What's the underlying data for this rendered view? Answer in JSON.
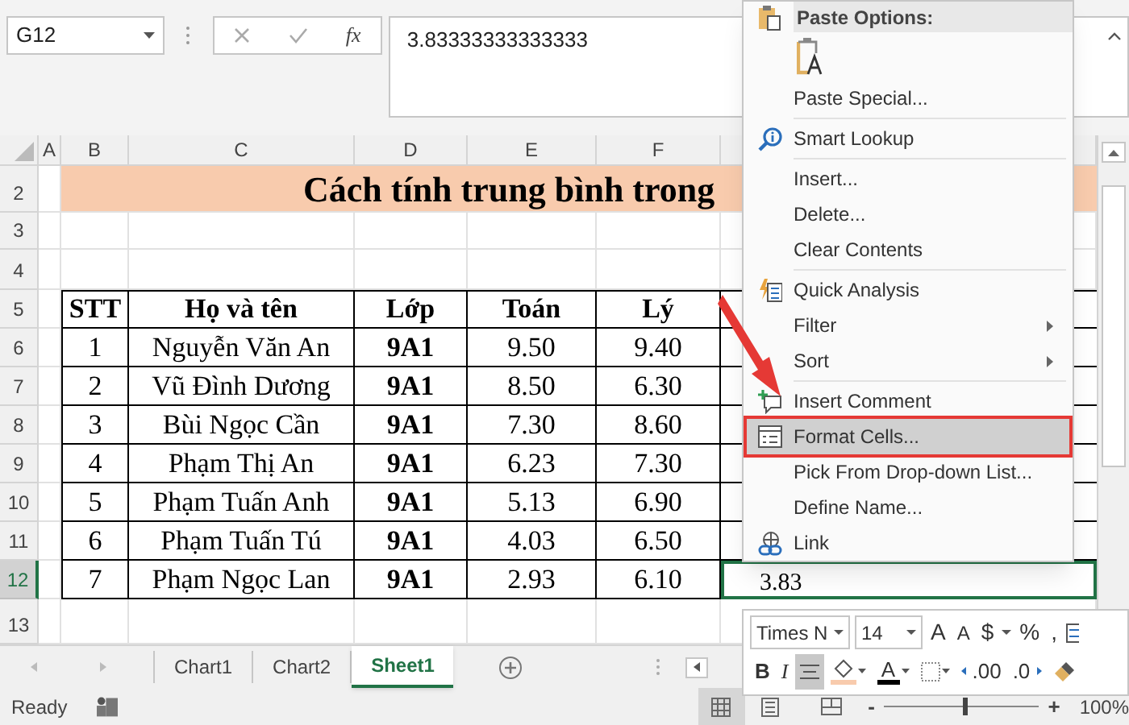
{
  "name_box": "G12",
  "formula_bar": {
    "function_label": "fx",
    "value": "3.83333333333333"
  },
  "column_headers": [
    "A",
    "B",
    "C",
    "D",
    "E",
    "F"
  ],
  "row_headers": [
    {
      "label": "2",
      "selected": false
    },
    {
      "label": "3",
      "selected": false
    },
    {
      "label": "4",
      "selected": false
    },
    {
      "label": "5",
      "selected": false
    },
    {
      "label": "6",
      "selected": false
    },
    {
      "label": "7",
      "selected": false
    },
    {
      "label": "8",
      "selected": false
    },
    {
      "label": "9",
      "selected": false
    },
    {
      "label": "10",
      "selected": false
    },
    {
      "label": "11",
      "selected": false
    },
    {
      "label": "12",
      "selected": true
    },
    {
      "label": "13",
      "selected": false
    }
  ],
  "title": "Cách tính trung bình trong",
  "table": {
    "columns": [
      "STT",
      "Họ và tên",
      "Lớp",
      "Toán",
      "Lý"
    ],
    "rows": [
      [
        "1",
        "Nguyễn Văn An",
        "9A1",
        "9.50",
        "9.40"
      ],
      [
        "2",
        "Vũ Đình Dương",
        "9A1",
        "8.50",
        "6.30"
      ],
      [
        "3",
        "Bùi Ngọc Cần",
        "9A1",
        "7.30",
        "8.60"
      ],
      [
        "4",
        "Phạm Thị An",
        "9A1",
        "6.23",
        "7.30"
      ],
      [
        "5",
        "Phạm Tuấn Anh",
        "9A1",
        "5.13",
        "6.90"
      ],
      [
        "6",
        "Phạm Tuấn Tú",
        "9A1",
        "4.03",
        "6.50"
      ],
      [
        "7",
        "Phạm Ngọc Lan",
        "9A1",
        "2.93",
        "6.10"
      ]
    ]
  },
  "active_cell": {
    "value": "3.83"
  },
  "context_menu": {
    "header": "Paste Options:",
    "items": [
      {
        "kind": "paste-button"
      },
      {
        "kind": "plain",
        "label": "Paste Special...",
        "submenu": false,
        "selected": false
      },
      {
        "kind": "separator"
      },
      {
        "kind": "lookup",
        "label": "Smart Lookup",
        "submenu": false,
        "selected": false
      },
      {
        "kind": "separator"
      },
      {
        "kind": "plain",
        "label": "Insert...",
        "submenu": false,
        "selected": false
      },
      {
        "kind": "plain",
        "label": "Delete...",
        "submenu": false,
        "selected": false
      },
      {
        "kind": "plain",
        "label": "Clear Contents",
        "submenu": false,
        "selected": false
      },
      {
        "kind": "separator"
      },
      {
        "kind": "analysis",
        "label": "Quick Analysis",
        "submenu": false,
        "selected": false
      },
      {
        "kind": "plain",
        "label": "Filter",
        "submenu": true,
        "selected": false
      },
      {
        "kind": "plain",
        "label": "Sort",
        "submenu": true,
        "selected": false
      },
      {
        "kind": "separator"
      },
      {
        "kind": "comment",
        "label": "Insert Comment",
        "submenu": false,
        "selected": false
      },
      {
        "kind": "format",
        "label": "Format Cells...",
        "submenu": false,
        "selected": true
      },
      {
        "kind": "plain",
        "label": "Pick From Drop-down List...",
        "submenu": false,
        "selected": false
      },
      {
        "kind": "plain",
        "label": "Define Name...",
        "submenu": false,
        "selected": false
      },
      {
        "kind": "link",
        "label": "Link",
        "submenu": false,
        "selected": false
      }
    ]
  },
  "mini_toolbar": {
    "font": "Times N",
    "size": "14",
    "top_buttons": [
      {
        "kind": "grow",
        "label": "A"
      },
      {
        "kind": "shrink",
        "label": "A"
      },
      {
        "kind": "text",
        "label": "$"
      },
      {
        "kind": "caret"
      },
      {
        "kind": "text",
        "label": "%"
      },
      {
        "kind": "text",
        "label": ","
      },
      {
        "kind": "wrap"
      }
    ],
    "bottom_buttons": [
      {
        "kind": "bold",
        "label": "B",
        "selected": false
      },
      {
        "kind": "italic",
        "label": "I",
        "selected": false
      },
      {
        "kind": "align",
        "selected": true
      },
      {
        "kind": "fill",
        "selected": false
      },
      {
        "kind": "font-color",
        "label": "A",
        "selected": false
      },
      {
        "kind": "borders",
        "selected": false
      },
      {
        "kind": "increase-decimal",
        "label": ".00",
        "selected": false
      },
      {
        "kind": "decrease-decimal",
        "label": ".0",
        "selected": false
      },
      {
        "kind": "painter",
        "selected": false
      }
    ]
  },
  "sheet_tabs": [
    {
      "label": "Chart1",
      "selected": false
    },
    {
      "label": "Chart2",
      "selected": false
    },
    {
      "label": "Sheet1",
      "selected": true
    }
  ],
  "status_bar": {
    "text": "Ready",
    "zoom_out": "-",
    "zoom_in": "+",
    "level": 0.5,
    "zoom": "100%"
  }
}
